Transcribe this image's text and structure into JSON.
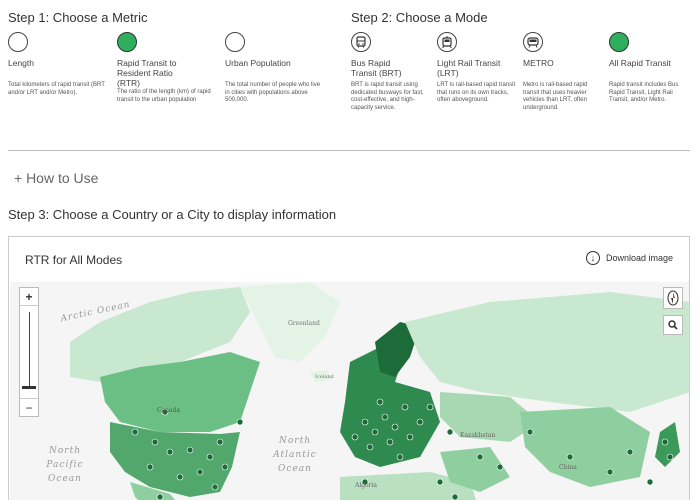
{
  "step1": {
    "title": "Step 1: Choose a Metric",
    "options": [
      {
        "label": "Length",
        "desc": "Total kilometers of rapid transit (BRT and/or LRT and/or Metro).",
        "selected": false
      },
      {
        "label": "Rapid Transit to Resident Ratio (RTR)",
        "desc": "The ratio of the length (km) of rapid transit to the urban population",
        "selected": true
      },
      {
        "label": "Urban Population",
        "desc": "The total number of people who live in cities with populations above 500,000.",
        "selected": false
      }
    ]
  },
  "step2": {
    "title": "Step 2: Choose a Mode",
    "options": [
      {
        "label": "Bus Rapid Transit (BRT)",
        "desc": "BRT is rapid transit using dedicated busways for fast, cost-effective, and high-capacity service.",
        "icon": "bus-icon",
        "selected": false
      },
      {
        "label": "Light Rail Transit (LRT)",
        "desc": "LRT is rail-based rapid transit that runs on its own tracks, often aboveground.",
        "icon": "tram-icon",
        "selected": false
      },
      {
        "label": "METRO",
        "desc": "Metro is rail-based rapid transit that uses heavier vehicles than LRT, often underground.",
        "icon": "metro-icon",
        "selected": false
      },
      {
        "label": "All Rapid Transit",
        "desc": "Rapid transit includes Bus Rapid Transit, Light Rail Transit, and/or Metro.",
        "icon": "",
        "selected": true
      }
    ]
  },
  "how_to_use": "+ How to Use",
  "step3": {
    "title": "Step 3: Choose a Country or a City to display information"
  },
  "panel": {
    "title": "RTR for All Modes",
    "download_label": "Download image"
  },
  "map": {
    "zoom_in": "+",
    "zoom_out": "−",
    "labels": {
      "arctic": "Arctic Ocean",
      "north_pacific": "North Pacific Ocean",
      "north_atlantic": "North Atlantic Ocean",
      "greenland": "Greenland",
      "iceland": "Iceland",
      "canada": "Canada",
      "kazakhstan": "Kazakhstan",
      "china": "China",
      "algeria": "Algeria"
    }
  },
  "colors": {
    "selected": "#2fae5e",
    "dark_green": "#1e6b3a",
    "mid_green": "#6cbf84",
    "light_green": "#c8e8cf",
    "pale_green": "#e3f3e6"
  }
}
